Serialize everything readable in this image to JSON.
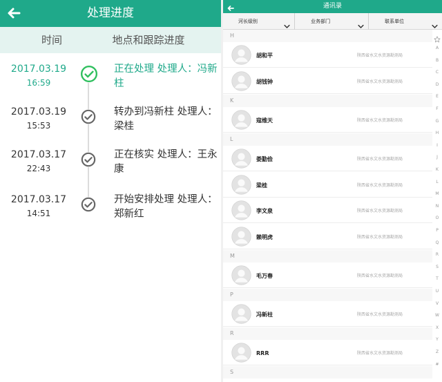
{
  "progress": {
    "title": "处理进度",
    "col_time": "时间",
    "col_progress": "地点和跟踪进度",
    "entries": [
      {
        "date": "2017.03.19",
        "time": "16:59",
        "desc": "正在处理 处理人：冯新柱",
        "active": true
      },
      {
        "date": "2017.03.19",
        "time": "15:53",
        "desc": "转办到冯新柱 处理人：梁桂",
        "active": false
      },
      {
        "date": "2017.03.17",
        "time": "22:43",
        "desc": "正在核实 处理人：王永康",
        "active": false
      },
      {
        "date": "2017.03.17",
        "time": "14:51",
        "desc": "开始安排处理 处理人：郑新红",
        "active": false
      }
    ]
  },
  "contacts": {
    "title": "通讯录",
    "filters": [
      {
        "label": "河长级别"
      },
      {
        "label": "业务部门"
      },
      {
        "label": "联系单位"
      }
    ],
    "sections": [
      {
        "letter": "H",
        "people": [
          {
            "name": "胡和平",
            "unit": "陕西省水文水资源勘测局"
          },
          {
            "name": "胡钱钟",
            "unit": "陕西省水文水资源勘测局"
          }
        ]
      },
      {
        "letter": "K",
        "people": [
          {
            "name": "寇维天",
            "unit": "陕西省水文水资源勘测局"
          }
        ]
      },
      {
        "letter": "L",
        "people": [
          {
            "name": "娄勤俭",
            "unit": "陕西省水文水资源勘测局"
          },
          {
            "name": "梁桂",
            "unit": "陕西省水文水资源勘测局"
          },
          {
            "name": "李文泉",
            "unit": "陕西省水文水资源勘测局"
          },
          {
            "name": "赖明虎",
            "unit": "陕西省水文水资源勘测局"
          }
        ]
      },
      {
        "letter": "M",
        "people": [
          {
            "name": "毛万春",
            "unit": "陕西省水文水资源勘测局"
          }
        ]
      },
      {
        "letter": "P",
        "people": [
          {
            "name": "冯新柱",
            "unit": "陕西省水文水资源勘测局"
          }
        ]
      },
      {
        "letter": "R",
        "people": [
          {
            "name": "RRR",
            "unit": "陕西省水文水资源勘测局"
          }
        ]
      },
      {
        "letter": "S",
        "people": []
      }
    ],
    "index": [
      "A",
      "B",
      "C",
      "D",
      "E",
      "F",
      "G",
      "H",
      "I",
      "J",
      "K",
      "L",
      "M",
      "N",
      "O",
      "P",
      "Q",
      "R",
      "S",
      "T",
      "U",
      "V",
      "W",
      "X",
      "Y",
      "Z",
      "#"
    ]
  },
  "icons": {
    "back": "arrow-left-icon",
    "done": "check-circle-icon",
    "dropdown": "chevron-down-icon",
    "favorite": "star-outline-icon",
    "avatar": "default-avatar-icon"
  },
  "colors": {
    "accent": "#1fa98a",
    "header_tint": "#e4f3f0",
    "muted": "#999999"
  }
}
